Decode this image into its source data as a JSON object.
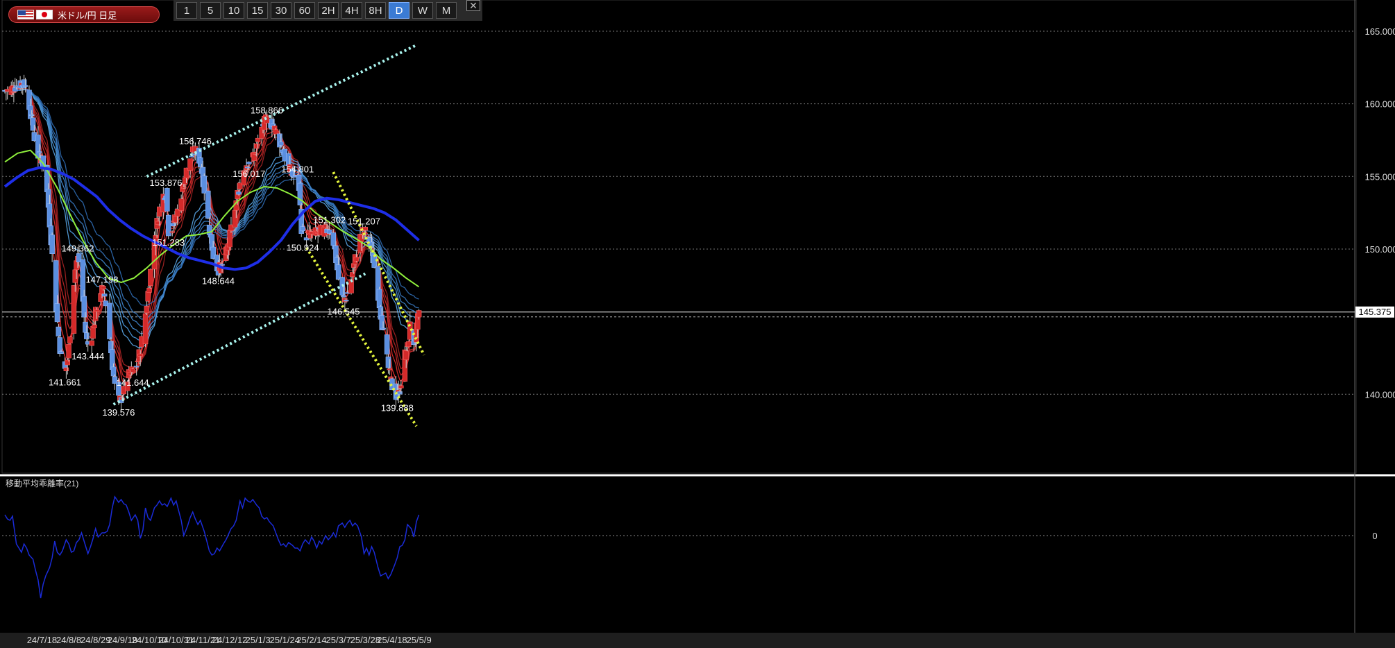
{
  "symbol": {
    "label": "米ドル/円 日足"
  },
  "timeframes": [
    {
      "label": "1",
      "active": false
    },
    {
      "label": "5",
      "active": false
    },
    {
      "label": "10",
      "active": false
    },
    {
      "label": "15",
      "active": false
    },
    {
      "label": "30",
      "active": false
    },
    {
      "label": "60",
      "active": false
    },
    {
      "label": "2H",
      "active": false
    },
    {
      "label": "4H",
      "active": false
    },
    {
      "label": "8H",
      "active": false
    },
    {
      "label": "D",
      "active": true
    },
    {
      "label": "W",
      "active": false
    },
    {
      "label": "M",
      "active": false
    }
  ],
  "close_symbol": "✕",
  "colors": {
    "bull": "#d42a2a",
    "bear": "#5b8fe0",
    "sma_long": "#1e2ee8",
    "ema_green": "#8fef3c",
    "trend_cyan": "#a9f4ee",
    "trend_yellow": "#e4f53c",
    "osc": "#1a2bd8"
  },
  "chart_data": [
    {
      "type": "candlestick",
      "title": "米ドル/円 日足",
      "x_tick_labels": [
        "24/7/18",
        "24/8/8",
        "24/8/29",
        "24/9/19",
        "24/10/10",
        "24/10/31",
        "24/11/21",
        "24/12/12",
        "25/1/3",
        "25/1/24",
        "25/2/14",
        "25/3/7",
        "25/3/28",
        "25/4/18",
        "25/5/9"
      ],
      "y_tick_labels": [
        "165.000",
        "160.000",
        "155.000",
        "150.000",
        "140.000"
      ],
      "ylim": [
        135,
        167
      ],
      "current_price": "145.375",
      "pivots": [
        {
          "label": "141.661",
          "date": "24/8/5",
          "value": 141.661,
          "type": "low"
        },
        {
          "label": "149.362",
          "date": "24/8/15",
          "value": 149.362,
          "type": "high"
        },
        {
          "label": "143.444",
          "date": "24/8/23",
          "value": 143.444,
          "type": "low"
        },
        {
          "label": "147.198",
          "date": "24/9/3",
          "value": 147.198,
          "type": "high"
        },
        {
          "label": "139.576",
          "date": "24/9/16",
          "value": 139.576,
          "type": "low"
        },
        {
          "label": "141.644",
          "date": "24/9/27",
          "value": 141.644,
          "type": "low"
        },
        {
          "label": "153.876",
          "date": "24/10/23",
          "value": 153.876,
          "type": "high"
        },
        {
          "label": "151.283",
          "date": "24/10/25",
          "value": 151.283,
          "type": "low"
        },
        {
          "label": "156.746",
          "date": "24/11/15",
          "value": 156.746,
          "type": "high"
        },
        {
          "label": "148.644",
          "date": "24/12/3",
          "value": 148.644,
          "type": "low"
        },
        {
          "label": "156.017",
          "date": "24/12/27",
          "value": 156.017,
          "type": "low"
        },
        {
          "label": "158.866",
          "date": "25/1/10",
          "value": 158.866,
          "type": "high"
        },
        {
          "label": "154.801",
          "date": "25/2/3",
          "value": 154.801,
          "type": "high"
        },
        {
          "label": "150.924",
          "date": "25/2/7",
          "value": 150.924,
          "type": "low"
        },
        {
          "label": "151.302",
          "date": "25/2/28",
          "value": 151.302,
          "type": "high"
        },
        {
          "label": "146.545",
          "date": "25/3/11",
          "value": 146.545,
          "type": "low"
        },
        {
          "label": "151.207",
          "date": "25/3/27",
          "value": 151.207,
          "type": "high"
        },
        {
          "label": "139.888",
          "date": "25/4/22",
          "value": 139.888,
          "type": "low"
        }
      ],
      "trendlines": [
        {
          "name": "upper-channel",
          "color": "cyan",
          "style": "dotted",
          "from": {
            "date": "24/10/8",
            "value": 155.0
          },
          "to": {
            "date": "25/5/6",
            "value": 164.0
          }
        },
        {
          "name": "lower-channel",
          "color": "cyan",
          "style": "dotted",
          "from": {
            "date": "24/9/12",
            "value": 139.3
          },
          "to": {
            "date": "25/3/28",
            "value": 148.3
          }
        },
        {
          "name": "down-upper",
          "color": "yellow",
          "style": "dotted",
          "from": {
            "date": "25/3/3",
            "value": 155.3
          },
          "to": {
            "date": "25/5/13",
            "value": 142.7
          }
        },
        {
          "name": "down-lower",
          "color": "yellow",
          "style": "dotted",
          "from": {
            "date": "25/2/10",
            "value": 150.1
          },
          "to": {
            "date": "25/5/7",
            "value": 137.8
          }
        }
      ],
      "moving_averages": {
        "sma_long": {
          "color": "blue",
          "values": [
            154.3,
            154.9,
            155.4,
            155.6,
            155.5,
            155.2,
            154.8,
            154.2,
            153.6,
            152.7,
            152.0,
            151.4,
            150.9,
            150.5,
            150.1,
            149.7,
            149.4,
            149.2,
            149.0,
            148.7,
            148.6,
            148.7,
            149.1,
            149.8,
            150.6,
            151.7,
            152.6,
            153.3,
            153.5,
            153.4,
            153.2,
            153.0,
            152.8,
            152.5,
            152.0,
            151.3,
            150.6
          ]
        },
        "ema_green": {
          "color": "green",
          "values": [
            156.0,
            156.6,
            156.8,
            155.9,
            154.2,
            152.4,
            150.6,
            149.1,
            148.0,
            147.7,
            148.0,
            148.7,
            149.6,
            150.3,
            150.9,
            151.0,
            151.2,
            152.3,
            153.3,
            153.9,
            154.3,
            154.2,
            153.8,
            153.3,
            152.5,
            151.9,
            151.3,
            150.8,
            150.2,
            149.3,
            148.7,
            148.0,
            147.4
          ]
        }
      }
    },
    {
      "type": "line",
      "title": "移動平均乖離率(21)",
      "y_tick_labels": [
        "0"
      ],
      "series": [
        {
          "values": [
            1.5,
            1.2,
            1.1,
            1.4,
            -0.6,
            -0.9,
            -1.2,
            -0.6,
            -0.9,
            -1.4,
            -1.7,
            -2.5,
            -3.2,
            -4.5,
            -3.5,
            -2.9,
            -2.3,
            -1.6,
            -0.4,
            -1.2,
            -1.4,
            -1.1,
            -0.3,
            -0.6,
            -1.2,
            -1.1,
            -0.5,
            -0.3,
            0.2,
            -0.7,
            -1.3,
            -0.8,
            -0.2,
            0.5,
            -0.1,
            0.2,
            0.2,
            0.3,
            0.8,
            2.0,
            2.8,
            2.4,
            2.6,
            2.3,
            2.2,
            1.7,
            1.1,
            1.5,
            1.1,
            -0.2,
            0.4,
            2.0,
            1.3,
            1.1,
            2.0,
            2.2,
            2.5,
            2.2,
            2.3,
            2.1,
            2.7,
            2.2,
            2.5,
            1.8,
            1.1,
            0.0,
            0.7,
            1.3,
            1.7,
            1.2,
            0.8,
            1.1,
            0.3,
            -0.4,
            -1.1,
            -1.4,
            -1.3,
            -0.9,
            -1.1,
            -0.6,
            -0.3,
            0.1,
            0.5,
            0.7,
            1.1,
            2.5,
            2.0,
            2.7,
            2.5,
            2.4,
            2.6,
            2.2,
            2.0,
            1.4,
            1.2,
            1.3,
            1.0,
            0.7,
            0.2,
            -0.3,
            -0.7,
            -0.6,
            -0.8,
            -0.5,
            -0.7,
            -0.9,
            -0.9,
            -1.1,
            -0.6,
            -0.3,
            -0.6,
            -0.1,
            -0.4,
            -0.9,
            -0.4,
            -0.6,
            0.0,
            -0.3,
            -0.1,
            0.2,
            -0.1,
            0.7,
            0.9,
            0.6,
            0.9,
            1.1,
            0.7,
            0.9,
            0.7,
            -0.1,
            -1.3,
            -0.9,
            -1.4,
            -0.8,
            -1.2,
            -2.3,
            -2.9,
            -2.8,
            -2.7,
            -3.1,
            -2.8,
            -2.1,
            -1.6,
            -0.8,
            -0.7,
            -0.3,
            0.8,
            0.5,
            -0.1,
            1.0,
            1.5
          ]
        }
      ],
      "zero_line": true
    }
  ]
}
